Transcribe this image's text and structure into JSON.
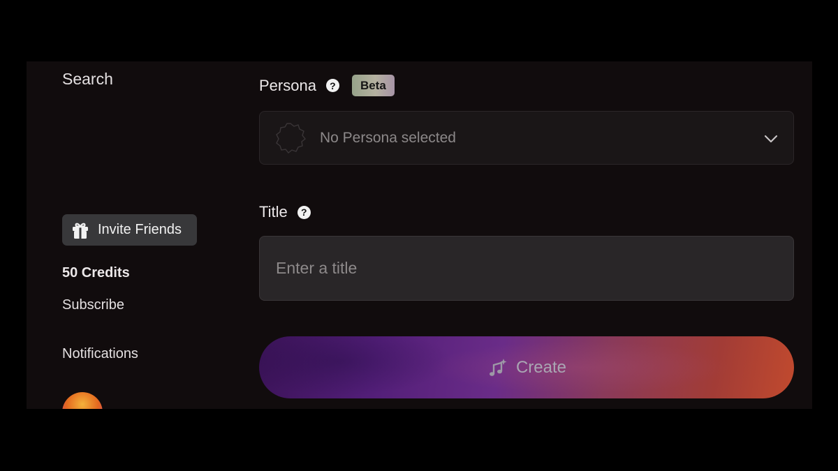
{
  "sidebar": {
    "search_label": "Search",
    "invite_label": "Invite Friends",
    "invite_icon": "gift-icon",
    "credits_label": "50 Credits",
    "subscribe_label": "Subscribe",
    "notifications_label": "Notifications"
  },
  "form": {
    "persona": {
      "label": "Persona",
      "badge": "Beta",
      "selected_text": "No Persona selected",
      "help_icon": "question-circle-icon",
      "dropdown_icon": "chevron-down-icon"
    },
    "title": {
      "label": "Title",
      "placeholder": "Enter a title",
      "value": "",
      "help_icon": "question-circle-icon"
    },
    "create_button": {
      "label": "Create",
      "icon": "music-sparkle-icon"
    }
  },
  "colors": {
    "page_background": "#000000",
    "app_background": "#110c0d",
    "create_gradient_start": "#3b1358",
    "create_gradient_end": "#c14a2e",
    "beta_badge": "#b5b1a0"
  }
}
